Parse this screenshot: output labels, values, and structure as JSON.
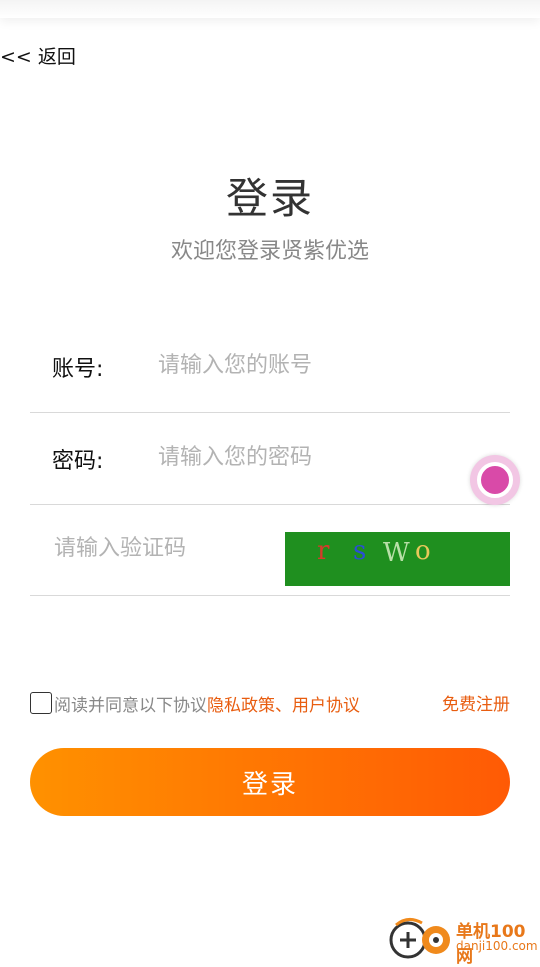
{
  "header": {
    "back_label": "<< 返回"
  },
  "login": {
    "title": "登录",
    "subtitle": "欢迎您登录贤紫优选",
    "account_label": "账号:",
    "account_placeholder": "请输入您的账号",
    "password_label": "密码:",
    "password_placeholder": "请输入您的密码",
    "captcha_placeholder": "请输入验证码",
    "captcha_chars": [
      "r",
      "s",
      "W",
      "o"
    ],
    "submit_label": "登录"
  },
  "agreement": {
    "prefix": "阅读并同意以下协议",
    "privacy_policy": "隐私政策",
    "separator": "、",
    "user_agreement": "用户协议",
    "register_label": "免费注册"
  },
  "watermark": {
    "line1": "单机100网",
    "line2": "danji100.com"
  },
  "colors": {
    "accent_orange": "#e85d10",
    "button_start": "#ff9100",
    "button_end": "#ff5a05",
    "captcha_bg": "#1f8f1f",
    "floating_button": "#d94aa8"
  }
}
